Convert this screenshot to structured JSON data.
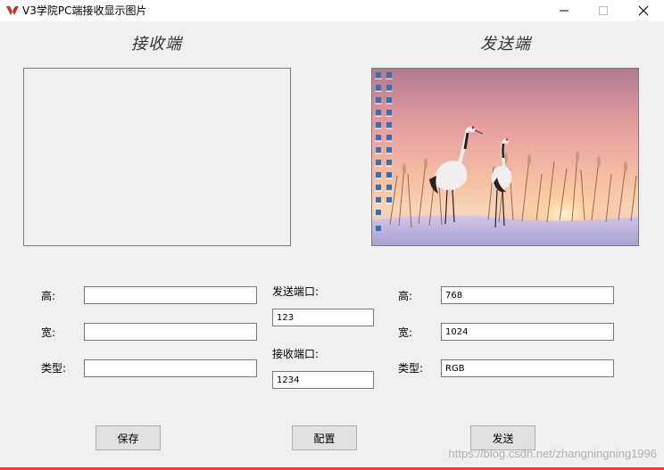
{
  "window": {
    "title": "V3学院PC端接收显示图片",
    "accent_color": "#c0392b"
  },
  "icons": {
    "app": "app-logo-icon",
    "minimize": "minimize-icon",
    "maximize": "maximize-icon",
    "close": "close-icon"
  },
  "receiver": {
    "heading": "接收端",
    "height_label": "高:",
    "width_label": "宽:",
    "type_label": "类型:",
    "height_value": "",
    "width_value": "",
    "type_value": ""
  },
  "ports": {
    "send_port_label": "发送端口:",
    "send_port_value": "123",
    "recv_port_label": "接收端口:",
    "recv_port_value": "1234"
  },
  "sender": {
    "heading": "发送端",
    "height_label": "高:",
    "width_label": "宽:",
    "type_label": "类型:",
    "height_value": "768",
    "width_value": "1024",
    "type_value": "RGB",
    "preview": "desktop screenshot with two cranes at sunset"
  },
  "buttons": {
    "save": "保存",
    "config": "配置",
    "send": "发送"
  },
  "watermark": "https://blog.csdn.net/zhangningning1996"
}
